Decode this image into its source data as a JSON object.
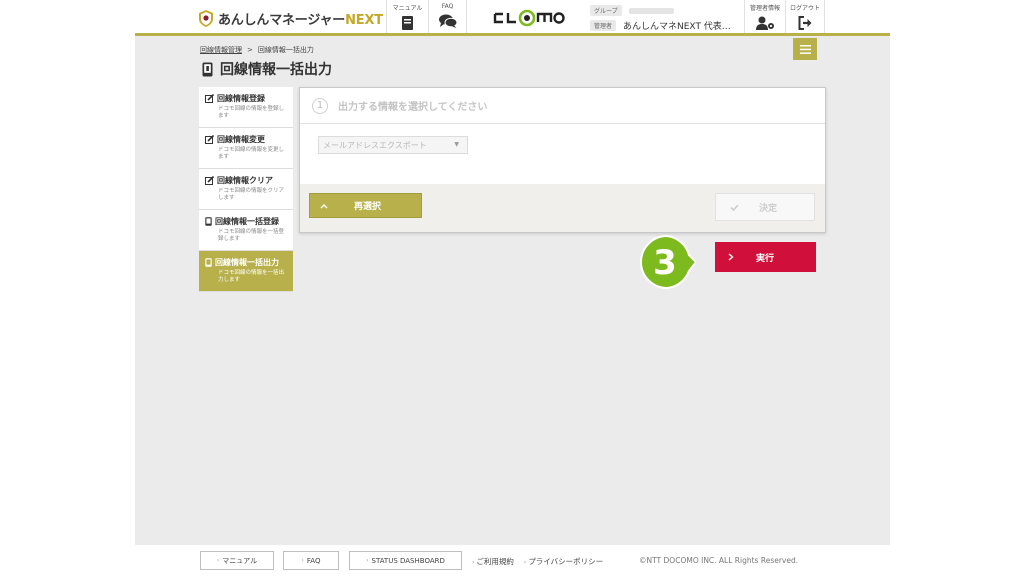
{
  "header": {
    "logo_text": "あんしんマネージャー",
    "logo_next": "NEXT",
    "manual_caption": "マニュアル",
    "faq_caption": "FAQ",
    "clomo_logo": "CLOMO",
    "group_tag": "グループ",
    "admin_tag": "管理者",
    "admin_name": "あんしんマネNEXT 代表…",
    "admin_info_caption": "管理者情報",
    "logout_caption": "ログアウト"
  },
  "breadcrumb": {
    "parent": "回線情報管理",
    "separator": ">",
    "current": "回線情報一括出力"
  },
  "page_title": "回線情報一括出力",
  "sidebar": {
    "items": [
      {
        "label": "回線情報登録",
        "desc": "ドコモ回線の情報を登録します",
        "icon": "edit-icon"
      },
      {
        "label": "回線情報変更",
        "desc": "ドコモ回線の情報を変更します",
        "icon": "edit-icon"
      },
      {
        "label": "回線情報クリア",
        "desc": "ドコモ回線の情報をクリアします",
        "icon": "edit-icon"
      },
      {
        "label": "回線情報一括登録",
        "desc": "ドコモ回線の情報を一括登録します",
        "icon": "phone-icon"
      },
      {
        "label": "回線情報一括出力",
        "desc": "ドコモ回線の情報を一括出力します",
        "icon": "phone-icon"
      }
    ],
    "active_index": 4
  },
  "panel": {
    "step_number": "1",
    "step_title": "出力する情報を選択してください",
    "select_value": "メールアドレスエクスポート",
    "reselect_label": "再選択",
    "confirm_label": "決定"
  },
  "execute_label": "実行",
  "step_badge": "3",
  "footer": {
    "manual": "マニュアル",
    "faq": "FAQ",
    "status": "STATUS DASHBOARD",
    "terms": "ご利用規約",
    "privacy": "プライバシーポリシー",
    "copyright": "©NTT DOCOMO INC. ALL Rights Reserved."
  },
  "colors": {
    "accent": "#b8b04a",
    "execute": "#d0103a",
    "badge": "#7dba1e"
  }
}
